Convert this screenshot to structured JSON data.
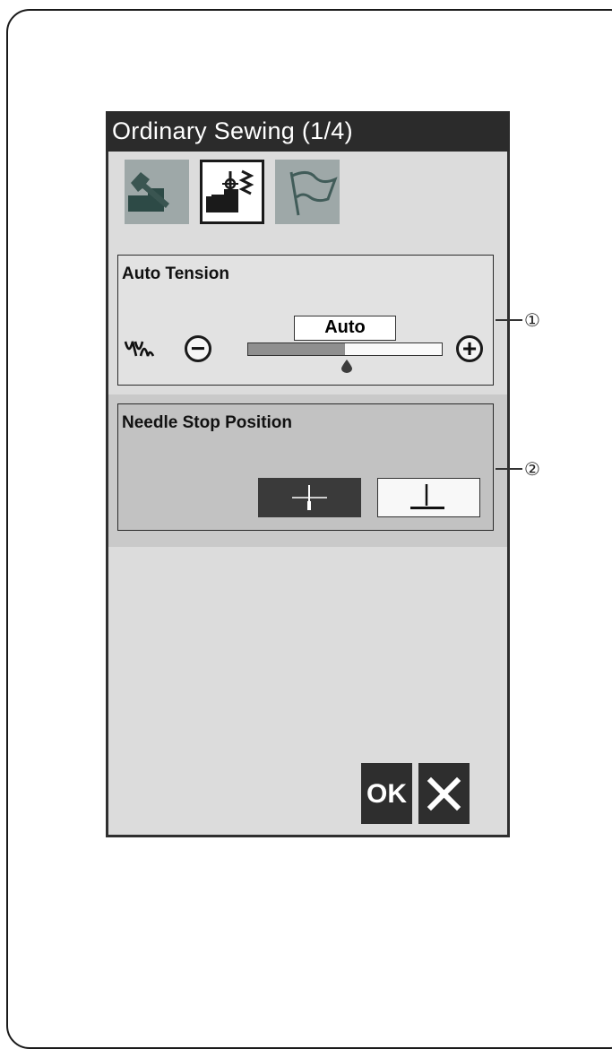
{
  "screen": {
    "title": "Ordinary Sewing (1/4)",
    "tabs": [
      {
        "icon": "machine-wrench-icon",
        "active": false
      },
      {
        "icon": "machine-stitch-icon",
        "active": true
      },
      {
        "icon": "flag-icon",
        "active": false
      }
    ]
  },
  "auto_tension": {
    "title": "Auto Tension",
    "value": "Auto",
    "minus_label": "−",
    "plus_label": "+",
    "slider_level": 0.5
  },
  "needle_stop": {
    "title": "Needle Stop Position",
    "options": [
      {
        "name": "needle-up",
        "selected": true
      },
      {
        "name": "needle-down",
        "selected": false
      }
    ]
  },
  "footer": {
    "ok_label": "OK",
    "cancel_icon": "close-icon"
  },
  "callouts": [
    "①",
    "②"
  ],
  "colors": {
    "titlebar": "#2b2b2b",
    "screen_bg": "#dcdcdc",
    "selected_button": "#3a3a3a"
  }
}
